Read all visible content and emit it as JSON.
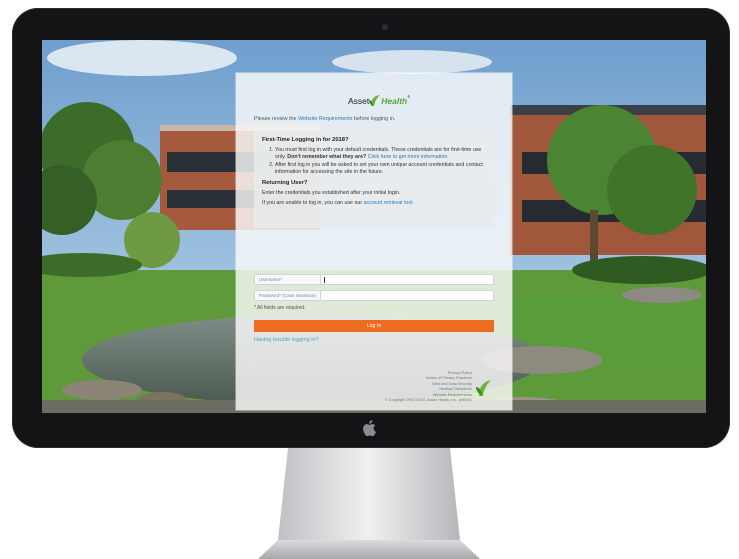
{
  "logo": {
    "asset": "Asset",
    "health": "Health",
    "mark": "®"
  },
  "review": {
    "prefix": "Please review the",
    "link": "Website Requirements",
    "suffix": "before logging in."
  },
  "first_time": {
    "heading": "First-Time Logging in for 2018?",
    "items": [
      {
        "text": "You must first log in with your default credentials. These credentials are for first-time use only.",
        "bold": "Don't remember what they are?",
        "link": "Click here to get more information."
      },
      {
        "text": "After first log in you will be asked to set your own unique account credentials and contact information for accessing the site in the future."
      }
    ]
  },
  "returning": {
    "heading": "Returning User?",
    "line1": "Enter the credentials you established after your initial login.",
    "line2_prefix": "If you are unable to log in, you can use our",
    "line2_link": "account retrieval tool."
  },
  "username": {
    "label": "Username*",
    "value": ""
  },
  "password": {
    "label": "Password* (Case Sensitive)",
    "value": ""
  },
  "required_note": "* All fields are required.",
  "login_button": "Log In",
  "trouble_link": "Having trouble logging in?",
  "footer": {
    "links": [
      "Privacy Policy",
      "Notice of Privacy Practices",
      "Web and Data Security",
      "Medical Disclaimer",
      "Website Requirements"
    ],
    "copyright": "© Copyright 2007-2018, Asset Health, Inc. (#9691)"
  },
  "colors": {
    "accent_orange": "#ee6c1f",
    "brand_green": "#5aa23a",
    "link_blue": "#2a7ab5"
  },
  "icons": [
    "asset-health-leaf-icon",
    "apple-logo-icon"
  ]
}
